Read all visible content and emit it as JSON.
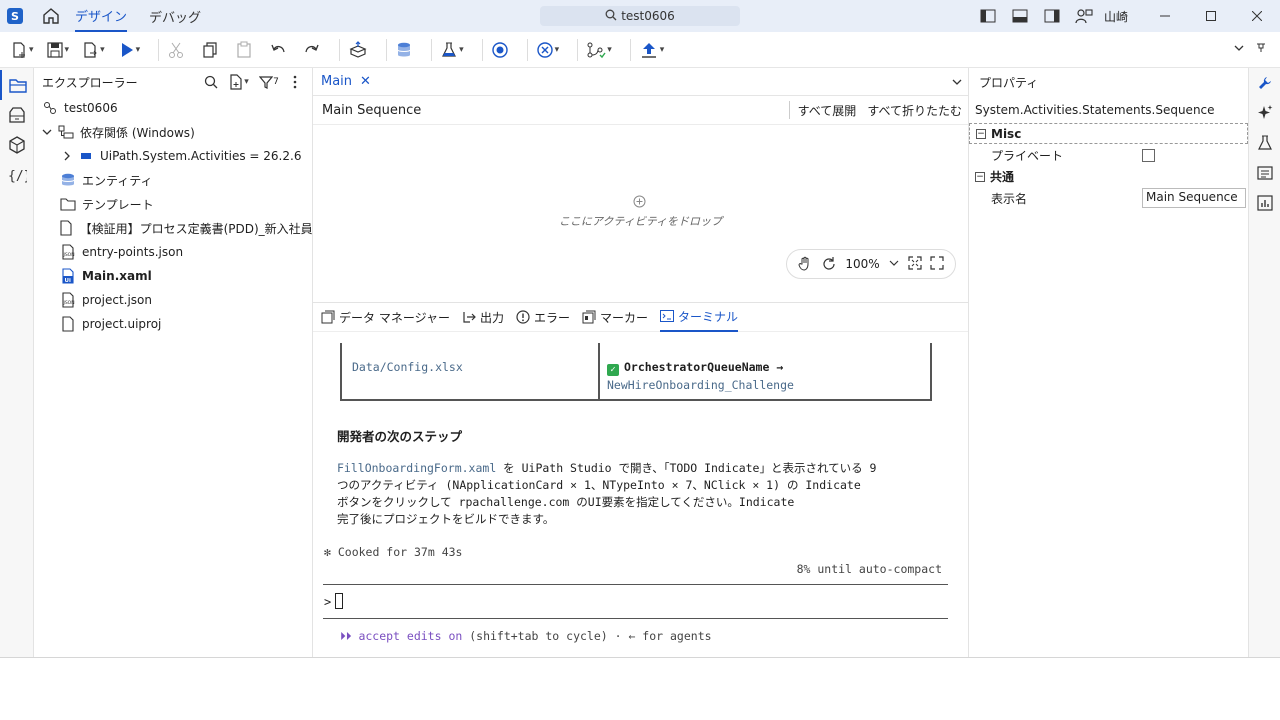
{
  "titlebar": {
    "logo": "S",
    "tabs": [
      {
        "label": "デザイン",
        "active": true
      },
      {
        "label": "デバッグ",
        "active": false
      }
    ],
    "search_text": "test0606",
    "username": "山崎",
    "icons": [
      "layout-left-icon",
      "layout-bottom-icon",
      "layout-right-icon",
      "user-feedback-icon"
    ]
  },
  "toolbar": {
    "buttons": [
      "new-icon",
      "save-icon",
      "export-icon",
      "run-icon",
      "cut-icon",
      "copy-icon",
      "paste-icon",
      "undo-icon",
      "redo-icon",
      "publish-package-icon",
      "data-service-icon",
      "test-flask-icon",
      "record-icon",
      "cancel-icon",
      "analyze-icon",
      "publish-icon"
    ]
  },
  "explorer": {
    "title": "エクスプローラー",
    "filter_badge": "7",
    "items": [
      {
        "label": "test0606",
        "icon": "project-icon",
        "indent": 0,
        "bold": false
      },
      {
        "label": "依存関係 (Windows)",
        "icon": "dependencies-icon",
        "indent": 0,
        "chevron": "down",
        "bold": false
      },
      {
        "label": "UiPath.System.Activities = 26.2.6",
        "icon": "package-icon",
        "indent": 1,
        "chevron": "right",
        "bold": false
      },
      {
        "label": "エンティティ",
        "icon": "entity-icon",
        "indent": 0,
        "bold": false
      },
      {
        "label": "テンプレート",
        "icon": "folder-icon",
        "indent": 0,
        "bold": false
      },
      {
        "label": "【検証用】プロセス定義書(PDD)_新入社員オン...",
        "icon": "file-icon",
        "indent": 0,
        "bold": false
      },
      {
        "label": "entry-points.json",
        "icon": "json-icon",
        "indent": 0,
        "bold": false
      },
      {
        "label": "Main.xaml",
        "icon": "xaml-icon",
        "indent": 0,
        "bold": true
      },
      {
        "label": "project.json",
        "icon": "json-icon",
        "indent": 0,
        "bold": false
      },
      {
        "label": "project.uiproj",
        "icon": "file-icon",
        "indent": 0,
        "bold": false
      }
    ]
  },
  "designer": {
    "tab_label": "Main",
    "sequence_name": "Main Sequence",
    "expand_all": "すべて展開",
    "collapse_all": "すべて折りたたむ",
    "drop_hint": "ここにアクティビティをドロップ",
    "zoom": "100%"
  },
  "bottom_panel": {
    "tabs": [
      {
        "label": "データ マネージャー",
        "icon": "data-manager-icon",
        "active": false
      },
      {
        "label": "出力",
        "icon": "output-icon",
        "active": false
      },
      {
        "label": "エラー",
        "icon": "error-icon",
        "active": false
      },
      {
        "label": "マーカー",
        "icon": "marker-icon",
        "active": false
      },
      {
        "label": "ターミナル",
        "icon": "terminal-icon",
        "active": true
      }
    ],
    "terminal": {
      "table_cell_left": "Data/Config.xlsx",
      "table_cell_right_key": "OrchestratorQueueName →",
      "table_cell_right_value": "NewHireOnboarding_Challenge",
      "heading": "開発者の次のステップ",
      "line1_file": "FillOnboardingForm.xaml",
      "line1_rest": " を UiPath Studio で開き、「TODO Indicate」と表示されている 9",
      "line2": "つのアクティビティ (NApplicationCard × 1、NTypeInto × 7、NClick × 1) の Indicate",
      "line3": "ボタンをクリックして rpachallenge.com のUI要素を指定してください。Indicate",
      "line4": "完了後にプロジェクトをビルドできます。",
      "cooked": "✻ Cooked for 37m 43s",
      "compact": "8% until auto-compact",
      "prompt": ">",
      "footer_arrows": "⏵⏵",
      "footer_accept": "accept edits on",
      "footer_rest": " (shift+tab to cycle) · ← for agents"
    }
  },
  "properties": {
    "title": "プロパティ",
    "type": "System.Activities.Statements.Sequence",
    "categories": [
      {
        "name": "Misc",
        "rows": [
          {
            "label": "プライベート",
            "kind": "checkbox",
            "value": false
          }
        ]
      },
      {
        "name": "共通",
        "rows": [
          {
            "label": "表示名",
            "kind": "text",
            "value": "Main Sequence"
          }
        ]
      }
    ]
  },
  "colors": {
    "accent": "#1a56c8",
    "titlebar_bg": "#e8eef8",
    "terminal_value": "#4a6a8a",
    "success": "#2fa84f"
  }
}
